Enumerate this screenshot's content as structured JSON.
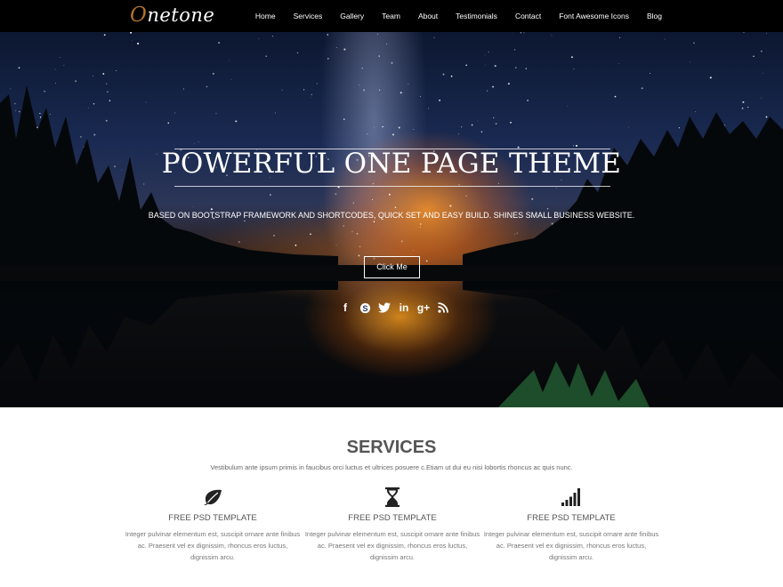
{
  "brand": {
    "logo_first": "O",
    "logo_rest": "netone",
    "accent": "#b27428"
  },
  "nav": {
    "items": [
      "Home",
      "Services",
      "Gallery",
      "Team",
      "About",
      "Testimonials",
      "Contact",
      "Font Awesome Icons",
      "Blog"
    ]
  },
  "hero": {
    "title": "POWERFUL ONE PAGE THEME",
    "subtitle": "BASED ON BOOTSTRAP FRAMEWORK AND SHORTCODES, QUICK SET AND EASY BUILD. SHINES SMALL BUSINESS WEBSITE.",
    "button": "Click Me",
    "social": [
      {
        "icon": "facebook-icon",
        "glyph": "f"
      },
      {
        "icon": "skype-icon",
        "glyph": "S"
      },
      {
        "icon": "twitter-icon",
        "glyph": "t"
      },
      {
        "icon": "linkedin-icon",
        "glyph": "in"
      },
      {
        "icon": "google-plus-icon",
        "glyph": "g+"
      },
      {
        "icon": "rss-icon",
        "glyph": "rss"
      }
    ]
  },
  "services": {
    "title": "SERVICES",
    "subtitle": "Vestibulum ante ipsum primis in faucibus orci luctus et ultrices posuere c.Etiam ut dui eu nisi lobortis rhoncus ac quis nunc.",
    "items": [
      {
        "icon": "leaf-icon",
        "heading": "FREE PSD TEMPLATE",
        "text": "Integer pulvinar elementum est, suscipit ornare ante finibus ac. Praesent vel ex dignissim, rhoncus eros luctus, dignissim arcu."
      },
      {
        "icon": "hourglass-icon",
        "heading": "FREE PSD TEMPLATE",
        "text": "Integer pulvinar elementum est, suscipit ornare ante finibus ac. Praesent vel ex dignissim, rhoncus eros luctus, dignissim arcu."
      },
      {
        "icon": "signal-icon",
        "heading": "FREE PSD TEMPLATE",
        "text": "Integer pulvinar elementum est, suscipit ornare ante finibus ac. Praesent vel ex dignissim, rhoncus eros luctus, dignissim arcu."
      }
    ]
  }
}
